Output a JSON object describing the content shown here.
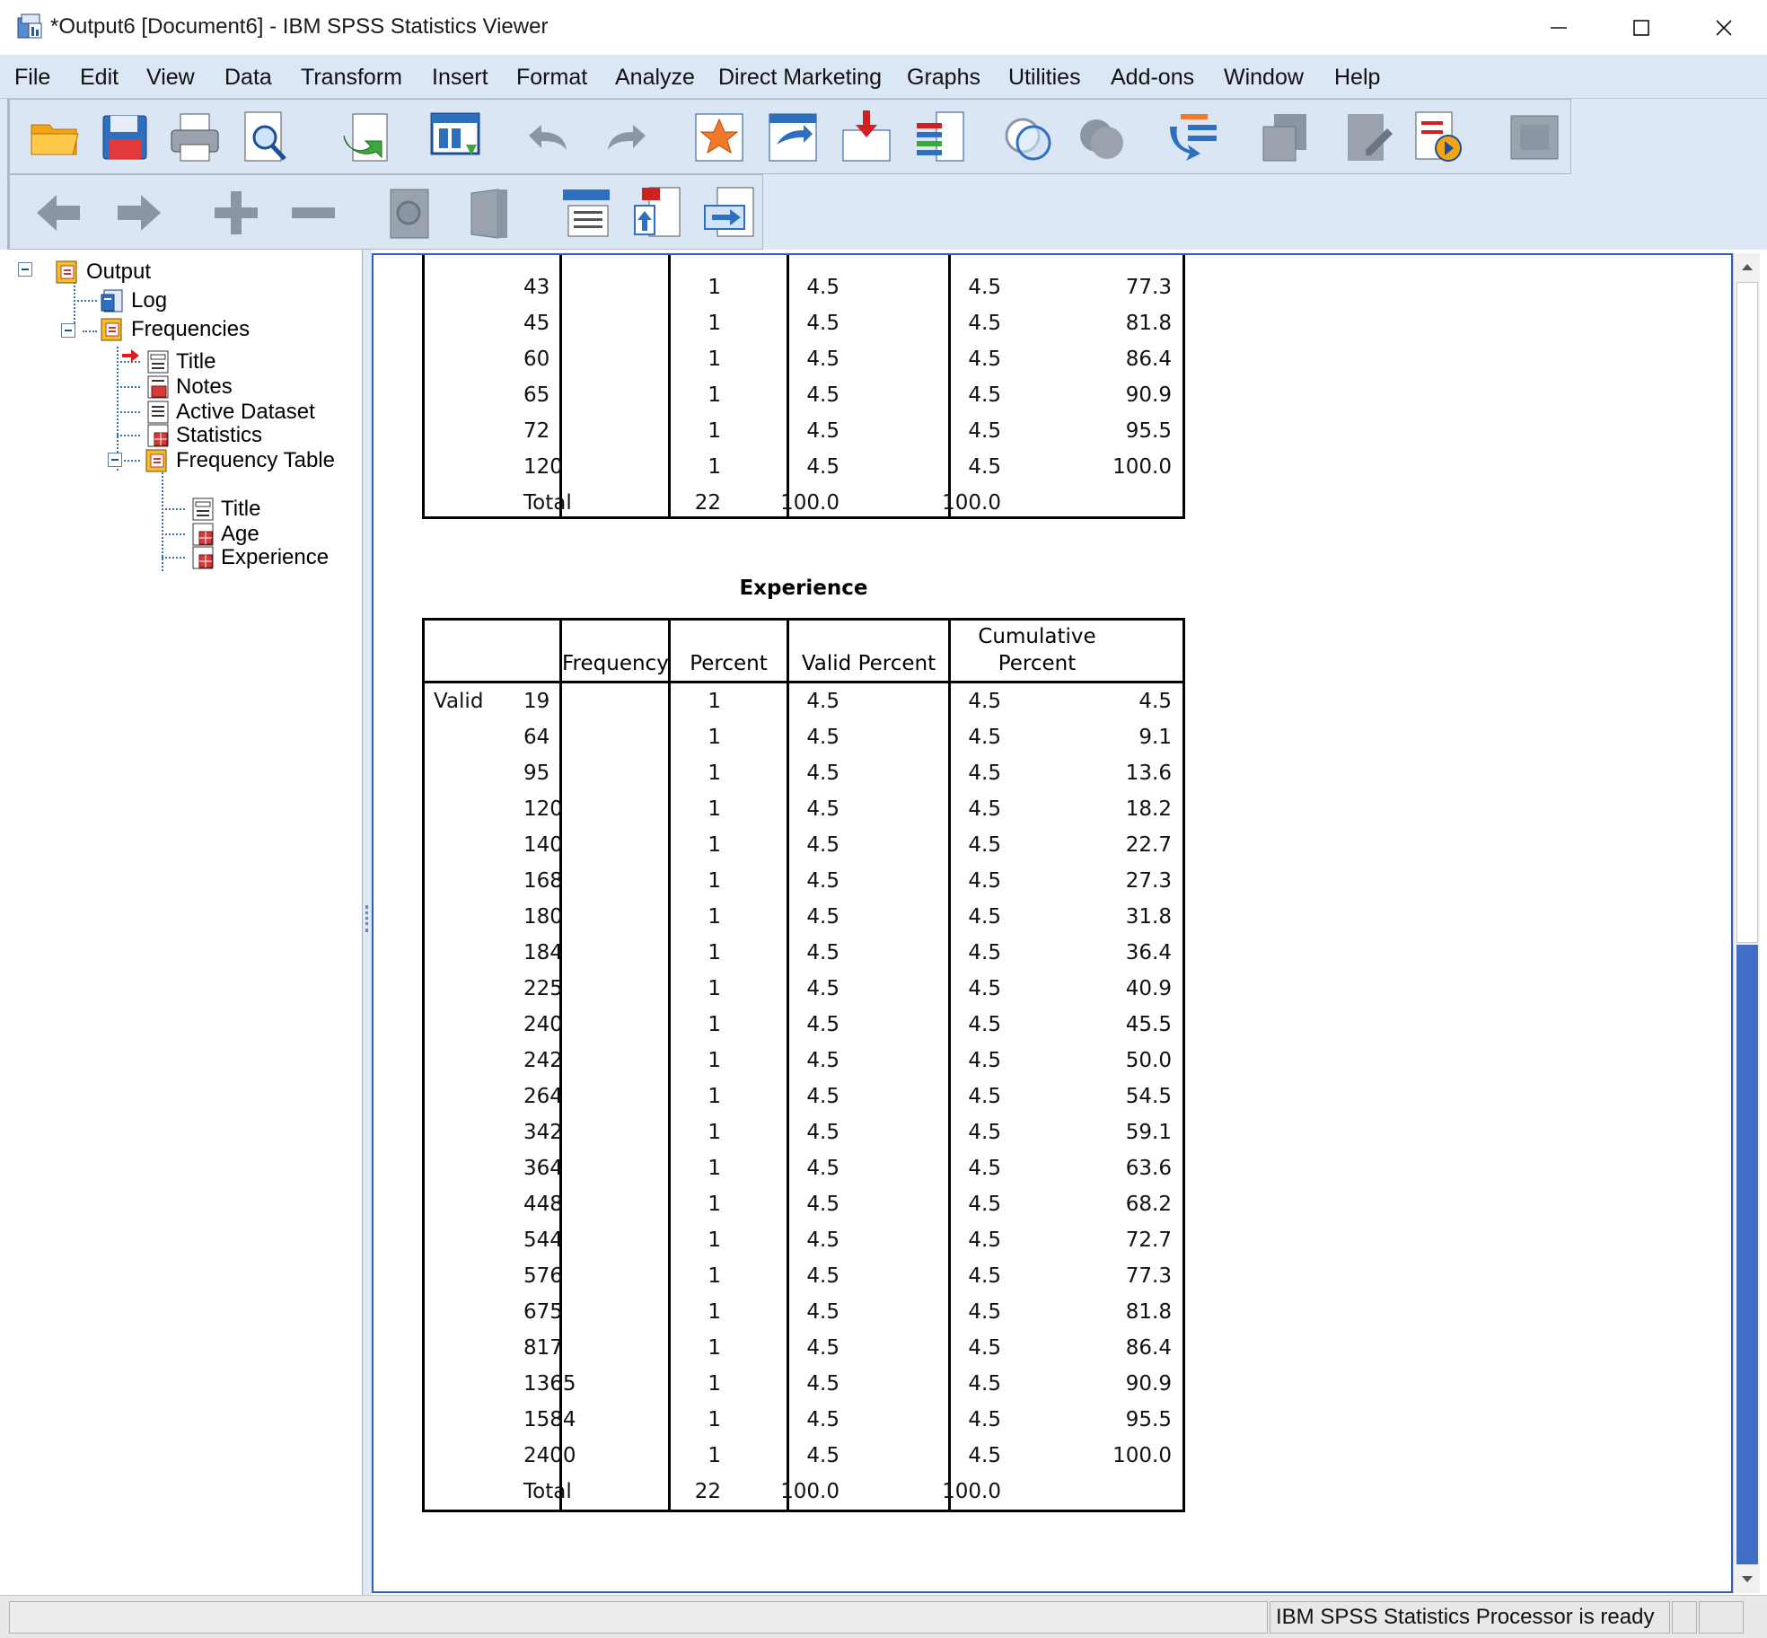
{
  "window": {
    "title": "*Output6 [Document6] - IBM SPSS Statistics Viewer"
  },
  "menu": [
    "File",
    "Edit",
    "View",
    "Data",
    "Transform",
    "Insert",
    "Format",
    "Analyze",
    "Direct Marketing",
    "Graphs",
    "Utilities",
    "Add-ons",
    "Window",
    "Help"
  ],
  "toolbar1": [
    "open-icon",
    "save-icon",
    "print-icon",
    "print-preview-icon",
    "export-icon",
    "recall-dialog-icon",
    "undo-icon",
    "redo-icon",
    "goto-data-icon",
    "goto-case-icon",
    "goto-variable-icon",
    "variables-icon",
    "venn-icon",
    "circles-icon",
    "use-sets-icon",
    "designate-window-icon",
    "edit-icon",
    "run-script-icon",
    "disabled-icon"
  ],
  "toolbar2": [
    "back-icon",
    "forward-icon",
    "expand-icon",
    "collapse-icon",
    "show-icon",
    "hide-icon",
    "insert-heading-icon",
    "insert-title-icon",
    "insert-text-icon"
  ],
  "outline": {
    "items": [
      {
        "label": "Output"
      },
      {
        "label": "Log"
      },
      {
        "label": "Frequencies"
      },
      {
        "label": "Title"
      },
      {
        "label": "Notes"
      },
      {
        "label": "Active Dataset"
      },
      {
        "label": "Statistics"
      },
      {
        "label": "Frequency Table"
      },
      {
        "label": "Title"
      },
      {
        "label": "Age"
      },
      {
        "label": "Experience"
      }
    ]
  },
  "age_table_partial": {
    "rows": [
      {
        "value": "43",
        "frequency": "1",
        "percent": "4.5",
        "valid_percent": "4.5",
        "cumulative_percent": "77.3"
      },
      {
        "value": "45",
        "frequency": "1",
        "percent": "4.5",
        "valid_percent": "4.5",
        "cumulative_percent": "81.8"
      },
      {
        "value": "60",
        "frequency": "1",
        "percent": "4.5",
        "valid_percent": "4.5",
        "cumulative_percent": "86.4"
      },
      {
        "value": "65",
        "frequency": "1",
        "percent": "4.5",
        "valid_percent": "4.5",
        "cumulative_percent": "90.9"
      },
      {
        "value": "72",
        "frequency": "1",
        "percent": "4.5",
        "valid_percent": "4.5",
        "cumulative_percent": "95.5"
      },
      {
        "value": "120",
        "frequency": "1",
        "percent": "4.5",
        "valid_percent": "4.5",
        "cumulative_percent": "100.0"
      }
    ],
    "total": {
      "label": "Total",
      "frequency": "22",
      "percent": "100.0",
      "valid_percent": "100.0"
    }
  },
  "experience_table": {
    "title": "Experience",
    "headers": {
      "frequency": "Frequency",
      "percent": "Percent",
      "valid_percent": "Valid Percent",
      "cumulative_1": "Cumulative",
      "cumulative_2": "Percent"
    },
    "valid_label": "Valid",
    "rows": [
      {
        "value": "19",
        "frequency": "1",
        "percent": "4.5",
        "valid_percent": "4.5",
        "cumulative_percent": "4.5"
      },
      {
        "value": "64",
        "frequency": "1",
        "percent": "4.5",
        "valid_percent": "4.5",
        "cumulative_percent": "9.1"
      },
      {
        "value": "95",
        "frequency": "1",
        "percent": "4.5",
        "valid_percent": "4.5",
        "cumulative_percent": "13.6"
      },
      {
        "value": "120",
        "frequency": "1",
        "percent": "4.5",
        "valid_percent": "4.5",
        "cumulative_percent": "18.2"
      },
      {
        "value": "140",
        "frequency": "1",
        "percent": "4.5",
        "valid_percent": "4.5",
        "cumulative_percent": "22.7"
      },
      {
        "value": "168",
        "frequency": "1",
        "percent": "4.5",
        "valid_percent": "4.5",
        "cumulative_percent": "27.3"
      },
      {
        "value": "180",
        "frequency": "1",
        "percent": "4.5",
        "valid_percent": "4.5",
        "cumulative_percent": "31.8"
      },
      {
        "value": "184",
        "frequency": "1",
        "percent": "4.5",
        "valid_percent": "4.5",
        "cumulative_percent": "36.4"
      },
      {
        "value": "225",
        "frequency": "1",
        "percent": "4.5",
        "valid_percent": "4.5",
        "cumulative_percent": "40.9"
      },
      {
        "value": "240",
        "frequency": "1",
        "percent": "4.5",
        "valid_percent": "4.5",
        "cumulative_percent": "45.5"
      },
      {
        "value": "242",
        "frequency": "1",
        "percent": "4.5",
        "valid_percent": "4.5",
        "cumulative_percent": "50.0"
      },
      {
        "value": "264",
        "frequency": "1",
        "percent": "4.5",
        "valid_percent": "4.5",
        "cumulative_percent": "54.5"
      },
      {
        "value": "342",
        "frequency": "1",
        "percent": "4.5",
        "valid_percent": "4.5",
        "cumulative_percent": "59.1"
      },
      {
        "value": "364",
        "frequency": "1",
        "percent": "4.5",
        "valid_percent": "4.5",
        "cumulative_percent": "63.6"
      },
      {
        "value": "448",
        "frequency": "1",
        "percent": "4.5",
        "valid_percent": "4.5",
        "cumulative_percent": "68.2"
      },
      {
        "value": "544",
        "frequency": "1",
        "percent": "4.5",
        "valid_percent": "4.5",
        "cumulative_percent": "72.7"
      },
      {
        "value": "576",
        "frequency": "1",
        "percent": "4.5",
        "valid_percent": "4.5",
        "cumulative_percent": "77.3"
      },
      {
        "value": "675",
        "frequency": "1",
        "percent": "4.5",
        "valid_percent": "4.5",
        "cumulative_percent": "81.8"
      },
      {
        "value": "817",
        "frequency": "1",
        "percent": "4.5",
        "valid_percent": "4.5",
        "cumulative_percent": "86.4"
      },
      {
        "value": "1365",
        "frequency": "1",
        "percent": "4.5",
        "valid_percent": "4.5",
        "cumulative_percent": "90.9"
      },
      {
        "value": "1584",
        "frequency": "1",
        "percent": "4.5",
        "valid_percent": "4.5",
        "cumulative_percent": "95.5"
      },
      {
        "value": "2400",
        "frequency": "1",
        "percent": "4.5",
        "valid_percent": "4.5",
        "cumulative_percent": "100.0"
      }
    ],
    "total": {
      "label": "Total",
      "frequency": "22",
      "percent": "100.0",
      "valid_percent": "100.0"
    }
  },
  "status": {
    "text": "IBM SPSS Statistics Processor is ready"
  },
  "colors": {
    "menubar": "#dbe7f5",
    "toolbar": "#dbe6f4",
    "selection_border": "#2f5fb5",
    "scroll_thumb": "#3f6ec4"
  }
}
